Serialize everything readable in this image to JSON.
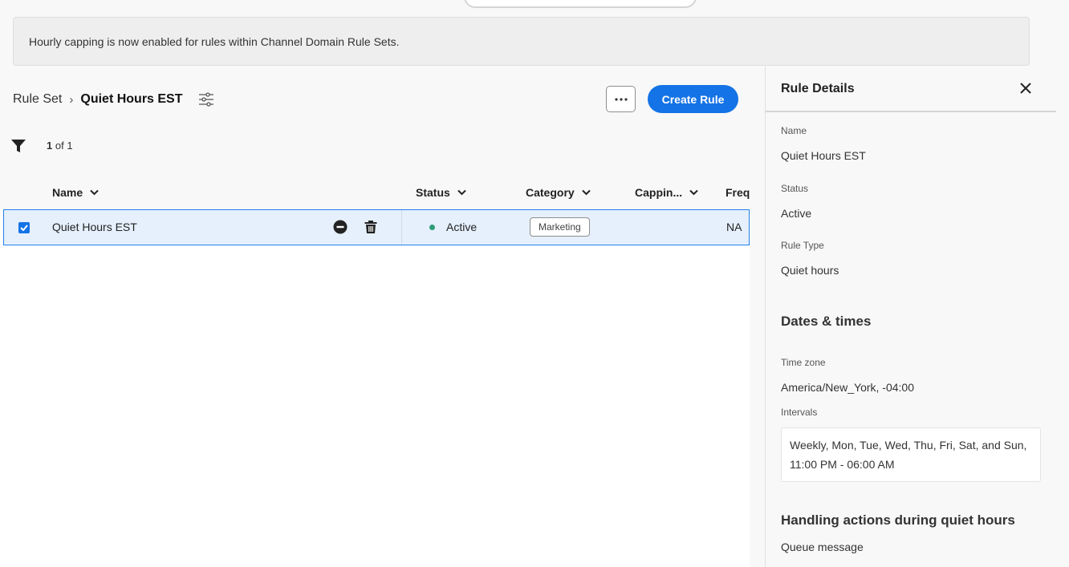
{
  "banner": {
    "text": "Hourly capping is now enabled for rules within Channel Domain Rule Sets."
  },
  "breadcrumb": {
    "root": "Rule Set",
    "separator": "›",
    "current": "Quiet Hours EST"
  },
  "toolbar": {
    "more_label": "•••",
    "create_label": "Create Rule"
  },
  "results": {
    "current": "1",
    "of_label": "of 1"
  },
  "table": {
    "columns": [
      "Name",
      "Status",
      "Category",
      "Cappin...",
      "Freq"
    ],
    "rows": [
      {
        "name": "Quiet Hours EST",
        "status": "Active",
        "category": "Marketing",
        "capping": "",
        "frequency": "NA",
        "selected": true
      }
    ]
  },
  "details": {
    "title": "Rule Details",
    "name_label": "Name",
    "name_value": "Quiet Hours EST",
    "status_label": "Status",
    "status_value": "Active",
    "rule_type_label": "Rule Type",
    "rule_type_value": "Quiet hours",
    "dates_heading": "Dates & times",
    "timezone_label": "Time zone",
    "timezone_value": "America/New_York, -04:00",
    "intervals_label": "Intervals",
    "intervals_line1": "Weekly, Mon, Tue, Wed, Thu, Fri, Sat, and Sun,",
    "intervals_line2": "11:00 PM - 06:00 AM",
    "handling_heading": "Handling actions during quiet hours",
    "handling_value": "Queue message"
  },
  "icons": [
    "settings-sliders-icon",
    "more-icon",
    "filter-icon",
    "chevron-down-icon",
    "checkmark-icon",
    "remove-circle-icon",
    "trash-icon",
    "close-icon"
  ],
  "colors": {
    "accent": "#1473e6",
    "status_active": "#2d9d78",
    "selected_row": "#e5f0fc"
  }
}
